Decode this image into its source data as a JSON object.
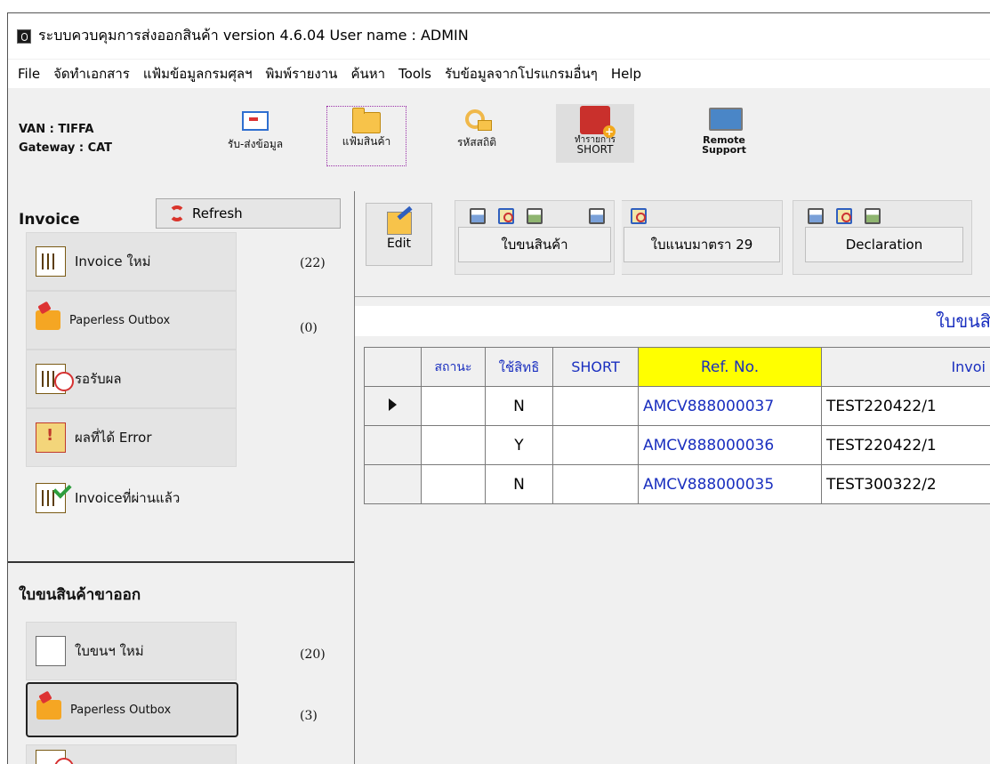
{
  "window": {
    "title": "ระบบควบคุมการส่งออกสินค้า version 4.6.04    User name : ADMIN"
  },
  "menu": [
    "File",
    "จัดทำเอกสาร",
    "แฟ้มข้อมูลกรมศุลฯ",
    "พิมพ์รายงาน",
    "ค้นหา",
    "Tools",
    "รับข้อมูลจากโปรแกรมอื่นๆ",
    "Help"
  ],
  "toolbar": {
    "van": "VAN : TIFFA",
    "gateway": "Gateway : CAT",
    "buttons": [
      {
        "label": "รับ-ส่งข้อมูล",
        "icon": "envelope-send-icon"
      },
      {
        "label": "แฟ้มสินค้า",
        "icon": "folder-icon"
      },
      {
        "label": "รหัสสถิติ",
        "icon": "key-folder-icon"
      },
      {
        "label": "ทำรายการ",
        "label2": "SHORT",
        "icon": "short-icon"
      },
      {
        "label": "Remote",
        "label2": "Support",
        "icon": "monitor-icon"
      }
    ]
  },
  "sidebar": {
    "invoice_header": "Invoice",
    "refresh_label": "Refresh",
    "invoice_items": [
      {
        "label": "Invoice ใหม่",
        "count": "(22)",
        "icon": "invoice-new-icon"
      },
      {
        "label": "Paperless Outbox",
        "count": "(0)",
        "icon": "paperless-outbox-icon"
      },
      {
        "label": "รอรับผล",
        "count": "",
        "icon": "pending-result-icon"
      },
      {
        "label": "ผลที่ได้ Error",
        "count": "",
        "icon": "error-result-icon"
      },
      {
        "label": "Invoiceที่ผ่านแล้ว",
        "count": "",
        "icon": "invoice-passed-icon"
      }
    ],
    "export_header": "ใบขนสินค้าขาออก",
    "export_items": [
      {
        "label": "ใบขนฯ ใหม่",
        "count": "(20)",
        "icon": "new-declaration-icon"
      },
      {
        "label": "Paperless Outbox",
        "count": "(3)",
        "icon": "paperless-outbox-icon"
      }
    ]
  },
  "main": {
    "edit_label": "Edit",
    "tabs": [
      {
        "label": "ใบขนสินค้า"
      },
      {
        "label": "ใบแนบมาตรา 29"
      },
      {
        "label": "Declaration"
      }
    ],
    "band_title": "ใบขนสิ",
    "columns": [
      "สถานะ",
      "ใช้สิทธิ",
      "SHORT",
      "Ref. No.",
      "Invoi"
    ],
    "rows": [
      {
        "status": "",
        "privilege": "N",
        "short": "",
        "ref": "AMCV888000037",
        "invoice": "TEST220422/1",
        "current": true
      },
      {
        "status": "",
        "privilege": "Y",
        "short": "",
        "ref": "AMCV888000036",
        "invoice": "TEST220422/1",
        "current": false
      },
      {
        "status": "",
        "privilege": "N",
        "short": "",
        "ref": "AMCV888000035",
        "invoice": "TEST300322/2",
        "current": false
      }
    ]
  },
  "colors": {
    "accent_blue": "#1a2fbf",
    "ref_header_bg": "#ffff00"
  }
}
